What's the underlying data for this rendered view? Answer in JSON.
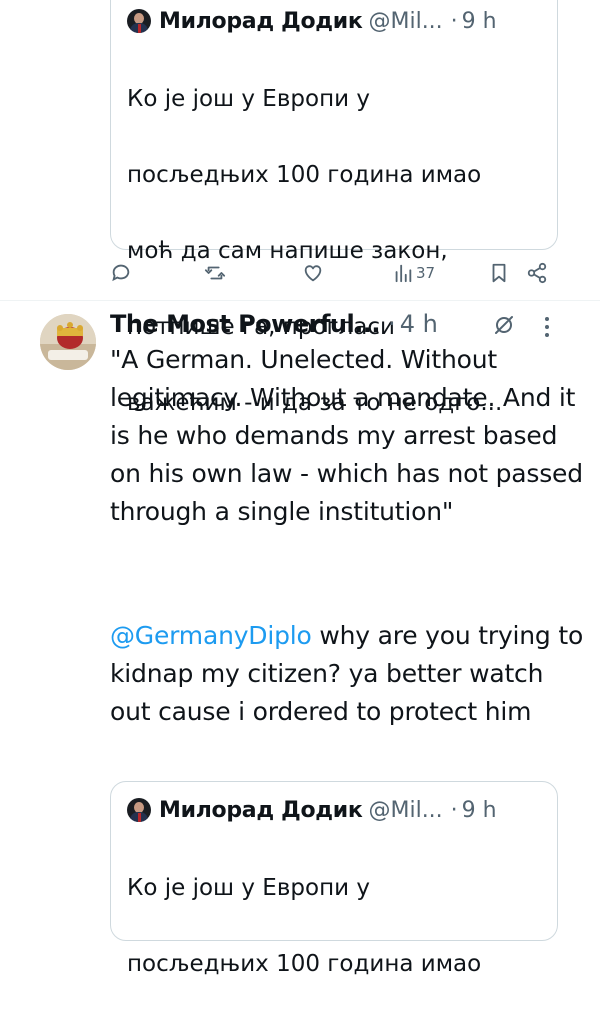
{
  "quoted_tweet": {
    "author_name": "Милорад Додик",
    "handle": "@Mil...",
    "separator": "·",
    "time": "9 h",
    "text_lines": [
      "Ко је још у Европи у",
      "посљедњих 100 година имао",
      "моћ да сам напише закон,",
      "потпише га, прогласи",
      "важећим - и да за то не одго..."
    ]
  },
  "action_bar": {
    "reply_icon": "reply-icon",
    "retweet_icon": "retweet-icon",
    "like_icon": "heart-icon",
    "views_icon": "views-icon",
    "views_count": "37",
    "bookmark_icon": "bookmark-icon",
    "share_icon": "share-icon"
  },
  "tweet": {
    "author_name": "The Most Powerful...",
    "separator": "·",
    "time": "4 h",
    "grok_icon": "grok-icon",
    "more_icon": "more-icon",
    "text_quote": "\"A German. Unelected. Without legitimacy. Without a mandate. And it is he who demands my arrest based on his own law - which has not passed through a single institution\"",
    "mention": "@GermanyDiplo",
    "text_reply": " why are you trying to kidnap my citizen? ya better watch out cause i ordered to protect him"
  },
  "quoted_tweet_2": {
    "author_name": "Милорад Додик",
    "handle": "@Mil...",
    "separator": "·",
    "time": "9 h",
    "text_lines": [
      "Ко је још у Европи у",
      "посљедњих 100 година имао"
    ]
  },
  "colors": {
    "link": "#1d9bf0",
    "secondary_text": "#536471",
    "border": "#cfd9de"
  }
}
